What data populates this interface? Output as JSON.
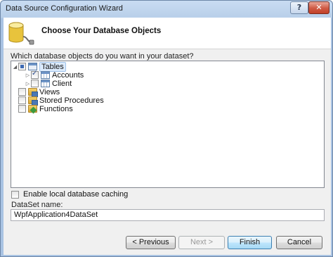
{
  "window": {
    "title": "Data Source Configuration Wizard",
    "help_glyph": "?",
    "close_glyph": "✕"
  },
  "header": {
    "title": "Choose Your Database Objects",
    "icon": "database-plug-icon"
  },
  "prompt": "Which database objects do you want in your dataset?",
  "tree": {
    "nodes": [
      {
        "label": "Tables",
        "state": "indeterminate",
        "expanded": true,
        "icon": "tables-icon",
        "selected": true
      },
      {
        "label": "Accounts",
        "state": "checked",
        "expanded": false,
        "icon": "table-icon"
      },
      {
        "label": "Client",
        "state": "unchecked",
        "expanded": false,
        "icon": "table-icon"
      },
      {
        "label": "Views",
        "state": "unchecked",
        "icon": "views-folder-icon"
      },
      {
        "label": "Stored Procedures",
        "state": "unchecked",
        "icon": "stored-procedures-folder-icon"
      },
      {
        "label": "Functions",
        "state": "unchecked",
        "icon": "functions-folder-icon"
      }
    ],
    "expanded_glyph": "◢",
    "collapsed_glyph": "▷"
  },
  "options": {
    "enable_caching_label": "Enable local database caching",
    "enable_caching_checked": false
  },
  "dataset": {
    "label": "DataSet name:",
    "value": "WpfApplication4DataSet"
  },
  "buttons": {
    "previous": "< Previous",
    "next": "Next >",
    "finish": "Finish",
    "cancel": "Cancel"
  },
  "colors": {
    "title_bar": "#b8cfe9",
    "close_button": "#c24128",
    "selection": "#dcebfc",
    "default_button": "#bee6fd"
  }
}
